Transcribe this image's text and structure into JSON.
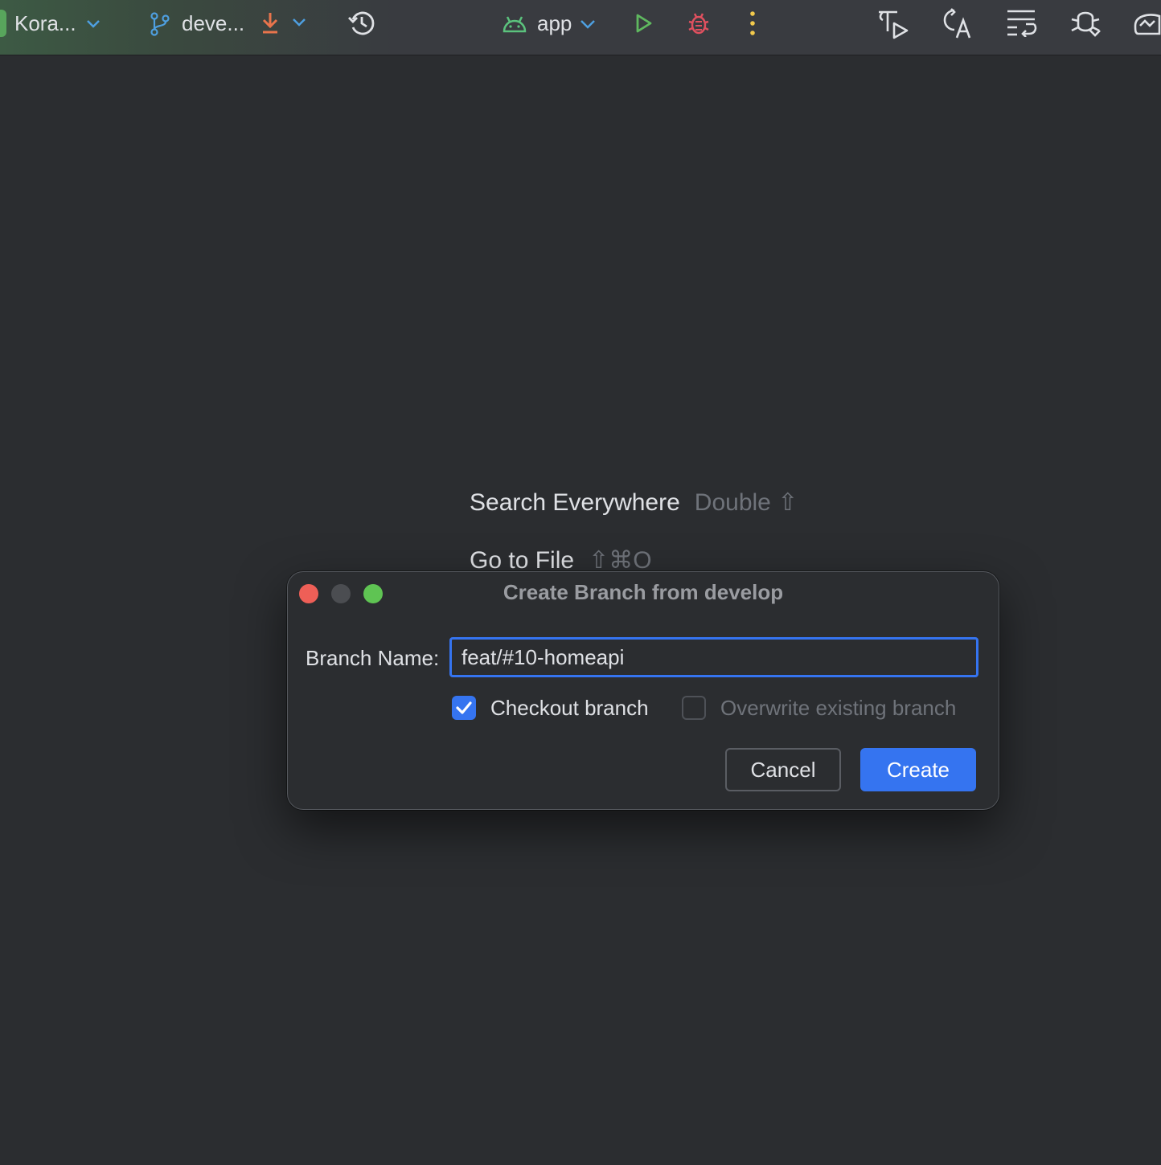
{
  "toolbar": {
    "project_name": "Kora...",
    "branch_name": "deve...",
    "run_config": "app",
    "colors": {
      "project_badge": "#58a55c",
      "branch_icon": "#4e9fe0",
      "update_icon": "#e8744c",
      "android_icon": "#5bc27d",
      "run_icon": "#5fb85f",
      "debug_icon": "#e0505f",
      "more_icon": "#f2c94c"
    },
    "icons": [
      "chevron-down-icon",
      "branch-icon",
      "update-project-icon",
      "history-icon",
      "android-icon",
      "run-icon",
      "debug-icon",
      "more-vertical-icon",
      "profile-icon",
      "translate-icon",
      "wrap-icon",
      "debugger-icon",
      "device-icon"
    ]
  },
  "editor_hints": {
    "search_everywhere": {
      "label": "Search Everywhere",
      "shortcut": "Double ⇧"
    },
    "go_to_file": {
      "label": "Go to File",
      "shortcut": "⇧⌘O"
    }
  },
  "dialog": {
    "title": "Create Branch from develop",
    "branch_label": "Branch Name:",
    "branch_value": "feat/#10-homeapi",
    "checkout": {
      "label": "Checkout branch",
      "checked": true
    },
    "overwrite": {
      "label": "Overwrite existing branch",
      "checked": false,
      "enabled": false
    },
    "cancel_label": "Cancel",
    "create_label": "Create",
    "accent_color": "#3574f0"
  }
}
